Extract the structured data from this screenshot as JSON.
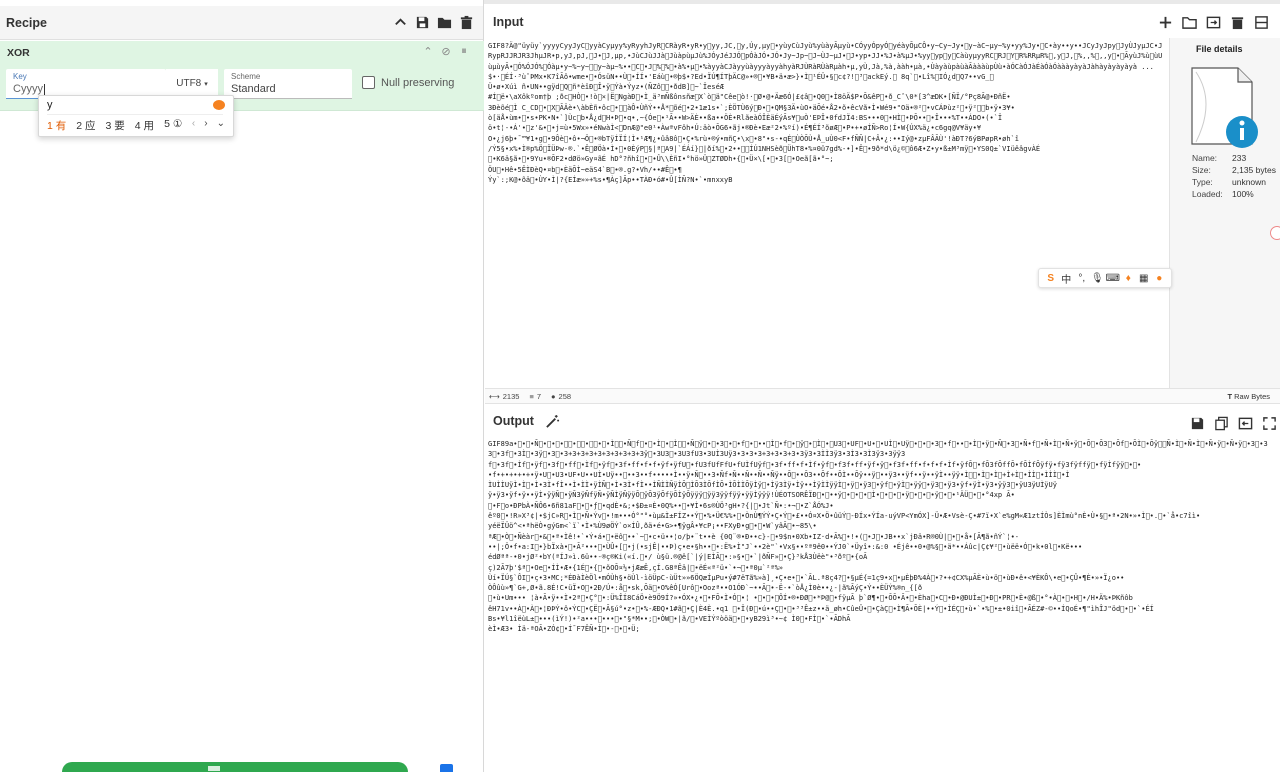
{
  "recipe": {
    "title": "Recipe",
    "operation": {
      "name": "XOR",
      "key": {
        "label": "Key",
        "value": "Cyyyy"
      },
      "key_encoding": "UTF8",
      "scheme": {
        "label": "Scheme",
        "value": "Standard"
      },
      "null_preserving": {
        "label": "Null preserving",
        "checked": false
      }
    }
  },
  "ime": {
    "composition": "y",
    "candidates": [
      "1 有",
      "2 应",
      "3 要",
      "4 用",
      "5 ①"
    ],
    "nav": [
      "‹",
      "›",
      "⌄"
    ]
  },
  "input": {
    "title": "Input",
    "text": "GIF8?Ä@\"üyüy`yyyyCyyJyC\u0000yyàCyµyy%yRyyhJyR\u0000CRàyR•yR•y\u0000yy,JC,\u0000y,Úy,µy\u0000•yùyCùJyù%yùàyÃµyù•CÓyyÓpyÓ\u0000yéàyÕµCÔ•y~Cy~Jy•\u0000y~àC~µy~%y•yy%Jy•\u0000C•ày••y••JCyJyJpy\u0000JyÙJyµJC•JRypRJJRJR3JhµJR•p,yJ,pJ,\u0000J•\u0000J,µp,•JùCJùJJà\u0000JùàpùµJù%JÓyJéJJÓ\u0000pÓàJÓ•JÓ•Jy~Jp~\u0000J~ÙJ~µJ•\u0000J•yp•JJ•%J•à%µJ•%yy\u0000yp\u0000y\u0000CàùyµyyRC\u0000RJ\u0000Y\u0000R%RRµR%\u0000,y\u0000J,\u0000%,,%\u0000,,y\u0000•\u0000ÃyùJ%ù\u0000ùUùµùyÃ•\u0000Ó%ÓJÓ%\u0000Óàµ•y~%~y~\u0000\u0000y~àµ~%••\u0000C\u0000•J\u0000%\u0000%\u0000•à%•µ\u0000•%àyyàCJàyyùàyyyàyyàhyàRJÙRàRÙàRµàh•µ,yÙ,Jà,%à,ààh•µà,•ÙàyàùpàùàÃàààùpÙù•àÓCàÓJàÉàÓàÓàààyàyàJàhàyàyàyàyà ...\n$•·\u0000ÉÍ·³ùˆÞMx•K7îÃô•wme•\u0000•ÓsüN••Ù\u0000•ÍÍ•'Eáù\u0000•®þ$•?Ed•ÏÚ¶ÍTþÄC@»•®\u0000•¥B•ä•æ>}•Ì\u0000¹ÉÜ•§\u0000c¢?!\u0000³\u0000ackEý.\u0000 8q`\u0000•Lî%\u0000IÓ¿d\u0000Q7••vG_\u0000\nÜ•ø•Xúì ñ•UN••gÿd\u0000Q\u0000ñ*èîÐ\u0000Î•ÿ\u0000Ýà•Ýyz•(ÑZô\u0000\u0000•ðdB]\u0000~`ÏeséÆ\n#Í\u0000ë•\\aXôkºom†þ ;ðc\u0000HÒ\u0000•!ò\u0000×|Ë\u0000NgàÐ\u0000•Ì_ä³mÑßônsñæ\u0000X`ò\u0000ä\"Cêe\u0000ò!·\u0000Ø•@•Äæ6Ó|£¢â\u0000•Q0\u0000•Ì8öÄ$P•Õ&êP\u0000•ð_Cˆ\\0*[3^æDK•[ÑÏ/°Pç8Ã@•ÐñË•\n3Ðèõé\u0000Ì C_CD\u0000•\u0000X\u0000ÃÄè•\\àbÈñ•ôc\u0000•\u0000\u0000àÔ•ÙñÝ••Å*\u0000õé\u0000•2•1æ1s•`;ÈÖTÙ6ý\u0000Ð•\u0000•QM§3Ä•ùO•äÕé•Å2•õ•êcVã•Ì•Wé9•\"Oä•®²\u0000•vCÁÞùz²\u0000•ÿ²\u0000\u0000b•ÿ•3¥•\nò[äÅ•ùm•\u0000•s•PK•N•`]Ùc\u0000b•Å¿d\u0000H•Þ\u0000•q•,~{Óe\u0000•¹Ã••W>ÄÈ••ßa••ÖÈ•RlãeàÓÎÈäÉýÃs¥\u0000uÒ'EÞÎ•0fdJÏ4:BS•••0\u0000•HÌ\u0000•ÞÕ••\u0000•Î•••%T••ÁDO•(•`Ï\nö•t¦-•Á'•\u0000z'&•\u0000•j=ù•5Wx»•éNwàÌ<\u0000DnÆ@\"e0¹•ÀwªvFôh•Ú:äò•ÕG6•ãj•®Ðè•Eæ²2•%ºí)•É¶ÉÍ³õøÆ\u0000•P•+•øÍÑ>Ro¦Í•W{ÚX%ä¿•c6gq@V¥äy•¥\nO•¿j6þ•¯™¥1•g\u0000•9Ôè\u0000•ô•¬Ö\u0000•®bTÿÍÏÍ¦Ì•¹Æ¶¿•ûâ8ô\u0000•Ç•%rù•®ý•mñÇ•\\x\u0000•8\"•s-•qÉ\u0000ÙÒÕÙ•Å_uÙ0<F•fÑÑ|C+Â•¿:••Iý@•zµFÂÃÙ'!àÐT?6ýBPøpR•øh`î\n/Ý5§•x%•Ì®p%Ö\u0000ÏÜÞw-®.`•Ê\u0000ØÖà•Ì•\u0000•0ÈýP\u0000§|ª\u0000A9|`ÉÁí}\u0000|ðí%\u0000•2••\u0000\u0000ÍÚ1NHSèð\u0000ÜhT8•%¤0û7gd%-•]•Ê\u0000•9ð*d\\ö¿©\u0000ô6Æ•Z•y•ß±M³mÿ\u0000•YS0Q±`VIüêâgvÀÉ\n\u0000•K6ä§ã•\u0000•9Yu•®ÕF2•dØö»Gy¤ãÉ hD°?ñhî\u0000•\u0000•Û\\\\ÈñI•°hö»Ü\u0000ZTØDh•{\u0000•Ü×\\[•\u0000•3[\u0000•Oeã[ã•°~;\nÖU\u0000•Hê•5ÊÌÐèQ•¤b\u0000•ÈäÕÌ~eäS4`B\u0000•®.g?•Vh/••#Ê\u0000•¶\nÝy`:;K@•õä\u0000•ÙY•Ì|?{EÍæ»»+%s•¶Àç]Ãp••TÀÐ•ó#•Û[ÌÑ?N•`•mnxxyB"
  },
  "file_details": {
    "title": "File details",
    "rows": [
      {
        "label": "Name:",
        "value": "233"
      },
      {
        "label": "Size:",
        "value": "2,135 bytes"
      },
      {
        "label": "Type:",
        "value": "unknown"
      },
      {
        "label": "Loaded:",
        "value": "100%"
      }
    ]
  },
  "status": {
    "length": "2135",
    "lines": "7",
    "position": "258",
    "raw_bytes": "Raw Bytes"
  },
  "output": {
    "title": "Output",
    "text": "GIF89a•\u0000•\u0000•Ñ\u0000•\u0000•\u0000•\u0000\u0000•\u0000\u0000•\u0000\u0000•\u0000•Ì\u0000\u0000•Ñ\u0000f\u0000•\u0000•Ì\u0000•\u0000Ì\u0000\u0000•Ñ\u0000ÿ\u0000•\u0000•3\u0000•\u0000•f\u0000•\u0000••\u0000Ì\u0000•f\u0000•\u0000ÿ\u0000•\u0000Ì\u0000•\u0000U3\u0000•UF\u0000•U•\u0000•UÌ\u0000•Uÿ\u0000•\u0000•\u0000•3\u0000•f\u0000••\u0000•Ì\u0000•ÿ\u0000•Ñ\u0000•3\u0000•Ñ•f\u0000•Ñ•Ì\u0000•Ñ•ÿ\u0000•Õ\u0000•Õ3\u0000•Õf\u0000•ÕÌ\u0000•Õÿ\u0000\u0000Ñ•Ì\u0000•Ñ•Ì\u0000•Ñ•ÿ\u0000•Ñ•ÿ\u0000•3\u0000•33\u0000•3f\u0000•3Ì\u0000•3ÿ\u0000•3\u0000•3+3+3+3+3+3+3+3+3+3ÿ\u0000•3U3\u0000•3U3fU3•3UÌ3Uÿ3•3•3•3+3+3•3+3•3ÿ3•3ÌÌ3ÿ3•3Ì3•3Ì3ÿ3•3ÿÿ3\nf\u0000•3f\u0000•Ìf\u0000•ÿf\u0000•3f\u0000•ff\u0000•Ìf\u0000•ÿf\u0000•3f•ff•f•f•ÿf•ÿfU\u0000•fU3fUfFfU•fUÌfUÿf\u0000•3f•ff•f•Ìf•ÿf\u0000•f3f•ff•ÿf•ÿ\u0000•f3f•ff•f•f•f•Ìf•ÿfÕ\u0000•fÕ3fÕffÕ•fÕÌfÕÿfÿ•fÿ3fÿffÿ\u0000•fÿÌfÿÿ\u0000•\u0000•\n•f•+•+•+•+•ÿ•U\u0000•U3•UF•U••UÌ•Uÿ••\u0000••3••f•••••Ì••ÿ•Ñ\u0000••3•Ñf•Ñ••Ñ••Ñ••Ñÿ••Õ\u0000••Õ3••Õf••ÕÌ••Õÿ••ÿ\u0000••ÿ3••ÿf••ÿ••ÿÌ••ÿÿ•Ì\u0000\u0000•Ì\u0000•Ì\u0000+Ì+Ì\u0000•ÌÌ\u0000•ÌÌÌ\u0000•Ì\nÌUÌÌUÿÌ•Ì\u0000•Ì•3Ì•fÌ••Ì•ÌÌ•ÿÌÑ\u0000•Ì•3Ì•fÌ••ÌÑÌÌÑÿÌÕ\u0000ÌÕ3ÌÕfÌÕ•ÌÕÌÌÕÿÌÿ\u0000•Ìÿ3Ìÿ•Ìÿ••ÌÿÌÌÿÿÌ\u0000•ÿ\u0000•ÿ3\u0000•ÿf\u0000•ÿÌ\u0000•ÿÿ\u0000•ÿ3\u0000•ÿ3•ÿf•ÿÌ•ÿ3•ÿÿ3\u0000•ÿU3ÿUÌÿUÿ\nÿ•ÿ3•ÿf•ÿ••ÿÌ•ÿÿÑ\u0000•ÿÑ3ÿÑfÿÑ•ÿÑÌÿÑÿÿÕ\u0000ÿÕ3ÿÕfÿÕÌÿÕÿÿÿ\u0000ÿÿ3ÿÿfÿÿ•ÿÿÌÿÿÿ!ÙÉOTSORÊÏÐ\u0000•\u0000••ÿ\u0000•\u0000•\u0000•\u0000Ì•\u0000•\u0000•\u0000•ÿ\u0000•\u0000•\u0000•ÿ\u0000•\u0000•¹ÄÜ\u0000•\u0000•°4xp Ã•\n\u0000•F\u0000o•ÐPbÀ•ÑÔ6•6ñ81aF\u0000•\u0000•ƒ\u0000•qdÈ•&;•$Ð±¤È•0Q%••\u0000•¥Ì•6s®ÙÖ³gH•?{|\u0000•Jt`Ñ•:•¬\u0000•Z`ÅÓ%J•\nêº0\u0000•!R»X³¢|•$jC»R\u0000•Ì\u0000•Ñ•Ýv\u0000•!m•••Ó°\"°•ùµ&Ì±FÍZ••Ý\u0000•%•Ü€%%•\u0000•ÒnÙ¶ÝÝ•Ç•Ý\u0000•£••Ó¤X•Ö•ûüÝ\u0000-ÐÍx•ÝÍa-uýVP<YmÓX]-Ü•Æ•Vsè-Ç•#7ï•X`e%gM«Æ1ztÍÒs]ÈÌmù°nÈ•Ù•§\u0000•ª•2N•»•Ì\u0000•.\u0000•`å•c7îì•\nyéëÏÜö^<•ªhëÒ•gýGm<`ï`•Ì•%Ù9øÖÝ`o×ÍÛ,ðä•é•G>•¶ÿgÂ•¥cP¡••FXyÐ•g\u0000•\u0000•W`yâÃ\u0000•~85\\•\nªÆ\u0000•Ò\u0000•Ñèàr\u0000•&\u0000•ª•Ìê!•`•Ý•á•\u0000•ëô\u0000••`~\u0000•c•ü••¦o/þ•¨t••è {0Q¨®•Ð••c}-\u0000•9$n•0Xb•IZ·d•Ã%\u0000•!•(\u0000•J\u0000•JB••x`jÐä•R®0Ù|\u0000•\u0000•å•[Ã¶ã•ñÝ`¦•-\n••|;Ö•f•a:I\u0000•}bÏxà•\u0000•Ã²•••\u0000•ÙÛ•[\u0000•j(•sjÊ|••Þ)ç•e•§h••\u0000•:Ë%•Ì\"J`••2è\"`•Vx§••ºª9ê0••ÝJ0`•Üyî•:&:0 •Éjê••0•@%§\u0000•ä*••Áûc|Ç¢¥²\u0000•ùëë•Ó\u0000•k•0l\u0000•Kë•••\nédØªª-•0•jØ²•bY(ªÍJ»ì.6ü••-®ç®Ki(«í.\u0000•/ ù§ü.®@ê[`|ý|EÌÃ\u0000•:»§•\u0000•`|ðÑF»\u0000•Ç}³kÅ3Ùëè\"•³ðº\u0000•{oÃ\nç)2Ã7þ'$ª\u0000•Oe\u0000•ÍÌ•Æ•{1É\u0000•{\u0000•õOÕ¤½•jÆæÊ,çÍ.G8ªÊä|\u0000•ëÉ«ª²ü•`•¬\u0000•ª0µ`²ª%»\nÙí•ÏÚ§`ÔI\u0000•ç•3•MC;*ÉÐàÌèÖl•mÓÙh§•öÙl-ìöÜpC-ùÜt»»6ÖQæÍµPu•ý#7ëTã%»à]¸•Ç•e•\u0000•`ÃL.ª8ç4?\u0000•§µÉ{=1ç9•x\u0000•µÈþÐ%4À\u0000•?•+¢CX%µÃÈ•ù•ö\u0000•ùÐ•ê•<¥ÈKÔ\\•e\u0000•ÇÛ•¶È•»•Ï¿o••\nÒÔûù»¶`G+,Ø•ã.8É!C•üÏ•O\u0000•2Ð/Ú•:å\u0000•sk,Õä\u0000•O%êÓ[Urô\u0000•Oozª••O1ÓÐ`~••Ã\u0000•-Ë-•`òÅ¿Ì0è••¿-|ã%ÃýÇ•Ý••ÈÜÝ%®n_{[ð\n\u0000•ù•Um••• ¦à•Ã•ÿ••Ì•2ª\u0000•Ç°\u0000•:Ü%ÎÍ8CáÖ•è9Ö9Í?»•ÓX•¿•\u0000•FÕ•Ì•Ó\u0000•¦ •\u0000•\u0000•\u0000ÔÍ•®•ÐØ\u0000•*Þ@\u0000•fÿµÃ þ`Ø¶•\u0000•ÕÕ•Ã•\u0000•Èha\u0000•C\u0000•Ð•@ÐUÌ±\u0000•Ð\u0000•PR\u0000•È•@ß\u0000•°•À\u0000•\u0000•H\u0000•/H•Ä%•ÞKñôb\nêH71v••À\u0000•À\u0000•¦ÐÞÝ•ô•ÝC\u0000•ÇË\u0000•Ã§ú°•z•\u0000•%-ÆÐQ•1#ã\u0000•Ç|È4È.•q1 \u0000•Ï(Ð\u0000•ú••Ç\u0000•\u0000•³³Ê±z••ä_øh•CûeÛ•\u0000•ÇàÇ\u0000•Ì¶Ã•ÕÈ|••Ý\u0000•ÌÉÇ\u0000•ù•`•%\u0000•±•0iî\u0000•ÃÉZ#-©••ÍQoÉ•¶\"ìhÎJ\"öd\u0000•\u0000•`•ÉÍ\nBs•¥l1îëùL±\u0000•••(ìÝ!)•²a•••\u0000•••\u0000•\"§*M••;\u0000•ÒW\u0000•|ã/\u0000•VEÌÝºòöä\u0000•\u0000•yB29ì³•~¢ Ì0\u0000•FÌ\u0000•`•ÃDhÃ\nèÌ•Æ3• Ìä-ªOÃ•ZÓ¢\u0000•Í¯F7ÊÑ•Ì\u0000•-\u0000•\u0000•Ü;"
  }
}
